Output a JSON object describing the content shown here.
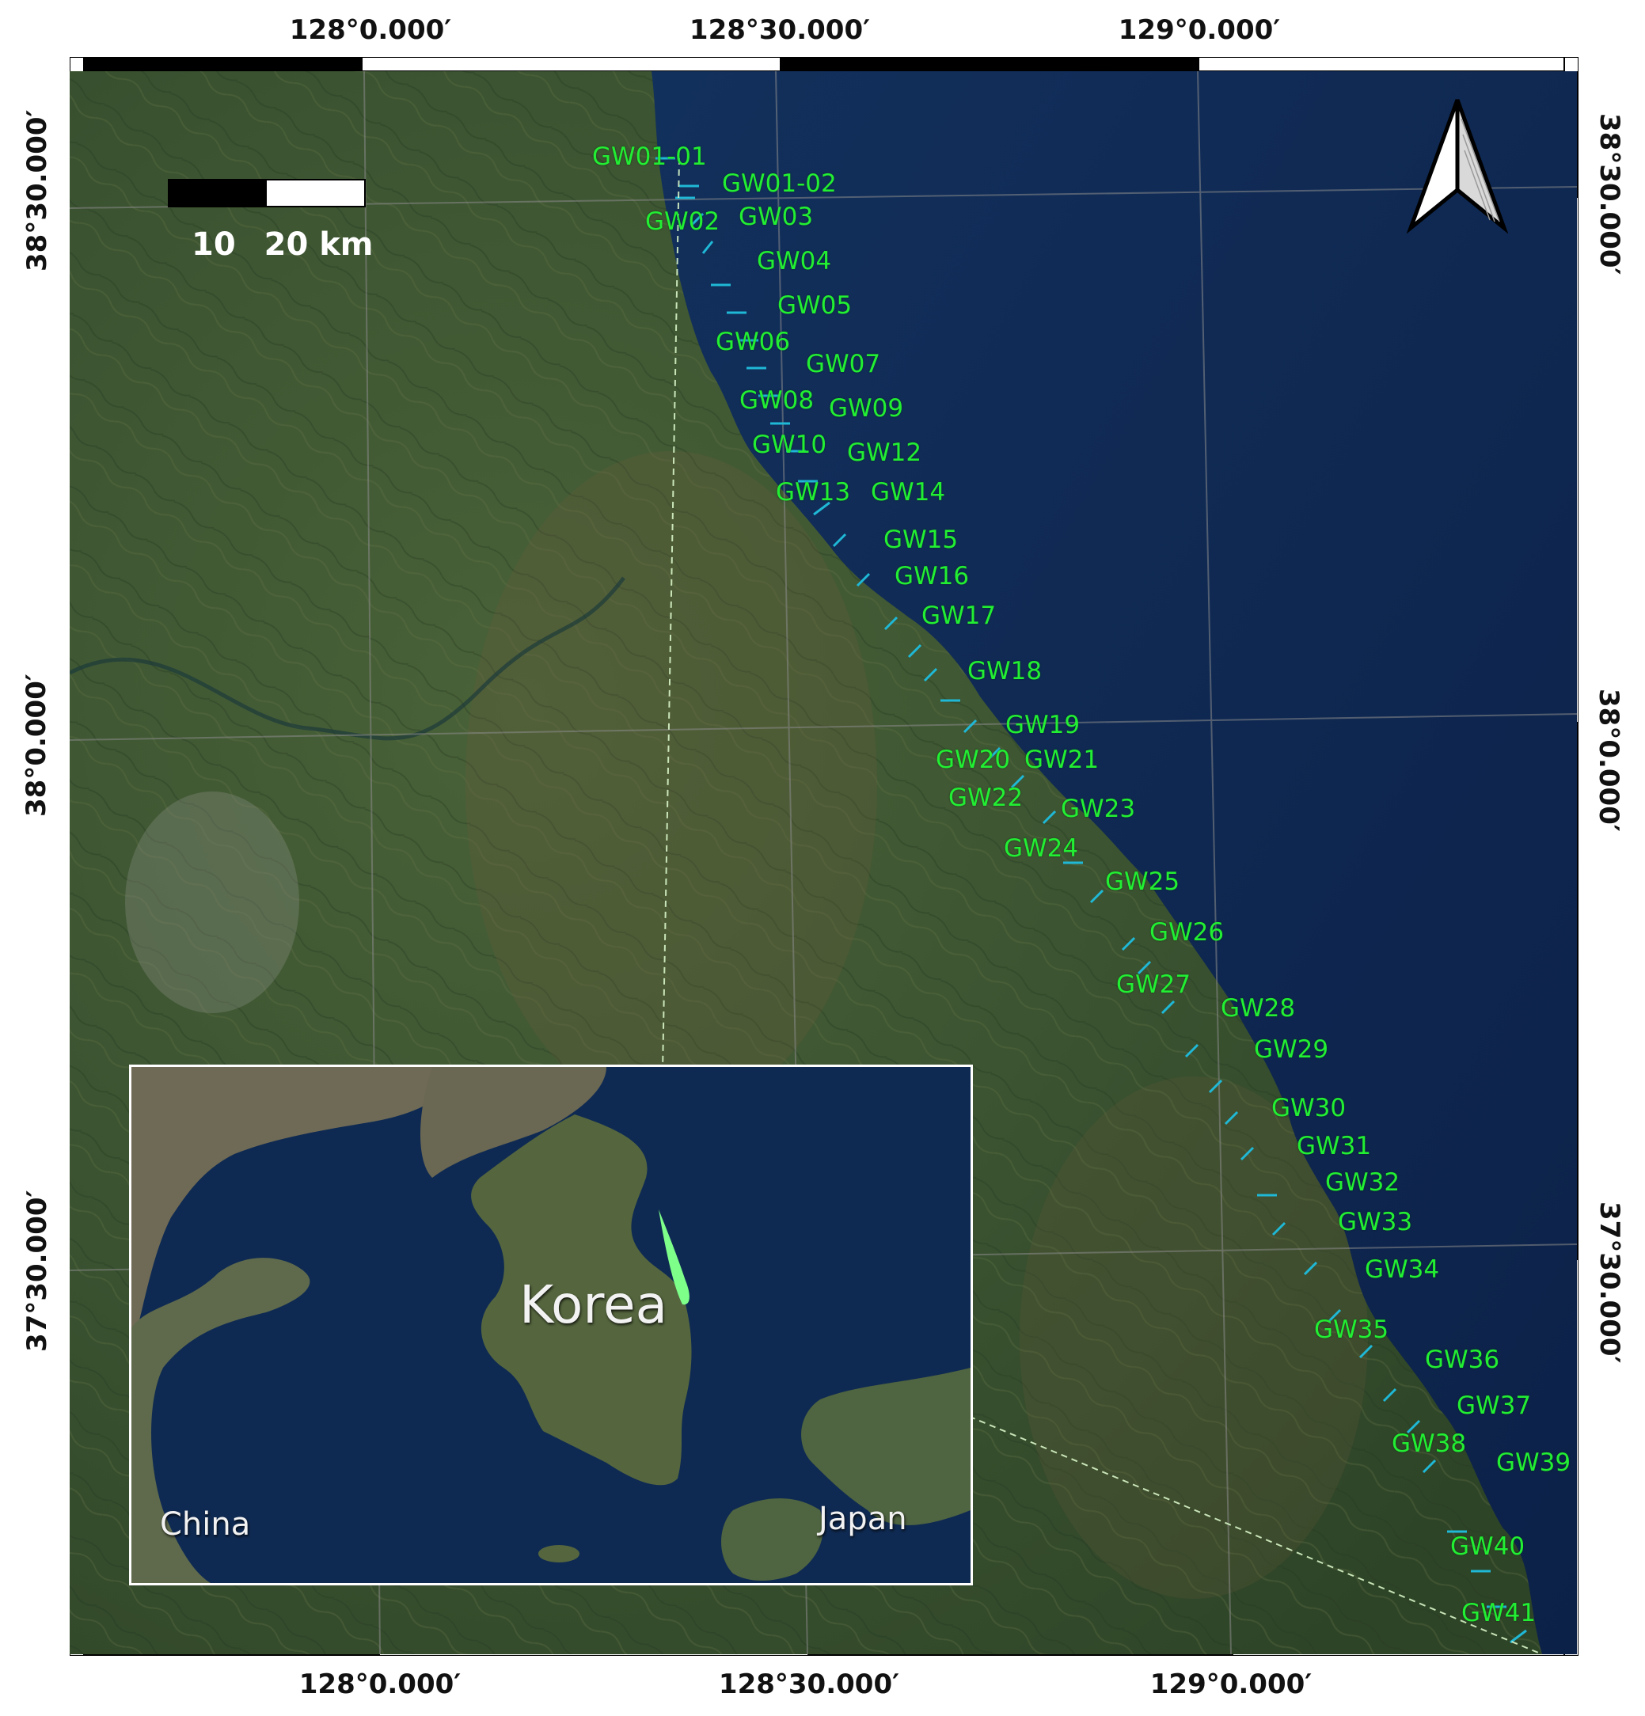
{
  "map": {
    "lon_ticks_top": [
      "128°0.000′",
      "128°30.000′",
      "129°0.000′"
    ],
    "lon_ticks_bottom": [
      "128°0.000′",
      "128°30.000′",
      "129°0.000′"
    ],
    "lat_ticks_left": [
      "38°30.000′",
      "38°0.000′",
      "37°30.000′"
    ],
    "lat_ticks_right": [
      "38°30.000′",
      "38°0.000′",
      "37°30.000′"
    ],
    "scale_bar": {
      "labels": [
        "10",
        "20 km"
      ]
    },
    "north_arrow": "north-arrow-icon",
    "stations": [
      "GW01-01",
      "GW01-02",
      "GW02",
      "GW03",
      "GW04",
      "GW05",
      "GW06",
      "GW07",
      "GW08",
      "GW09",
      "GW10",
      "GW12",
      "GW13",
      "GW14",
      "GW15",
      "GW16",
      "GW17",
      "GW18",
      "GW19",
      "GW20",
      "GW21",
      "GW22",
      "GW23",
      "GW24",
      "GW25",
      "GW26",
      "GW27",
      "GW28",
      "GW29",
      "GW30",
      "GW31",
      "GW32",
      "GW33",
      "GW34",
      "GW35",
      "GW36",
      "GW37",
      "GW38",
      "GW39",
      "GW40",
      "GW41"
    ],
    "inset": {
      "labels": {
        "korea": "Korea",
        "china": "China",
        "japan": "Japan"
      }
    },
    "colors": {
      "sea": "#0f2a52",
      "land": "#3b5233",
      "station_label": "#22ee33",
      "station_marker": "#1fb8d6",
      "highlight": "#7dff8a"
    }
  }
}
